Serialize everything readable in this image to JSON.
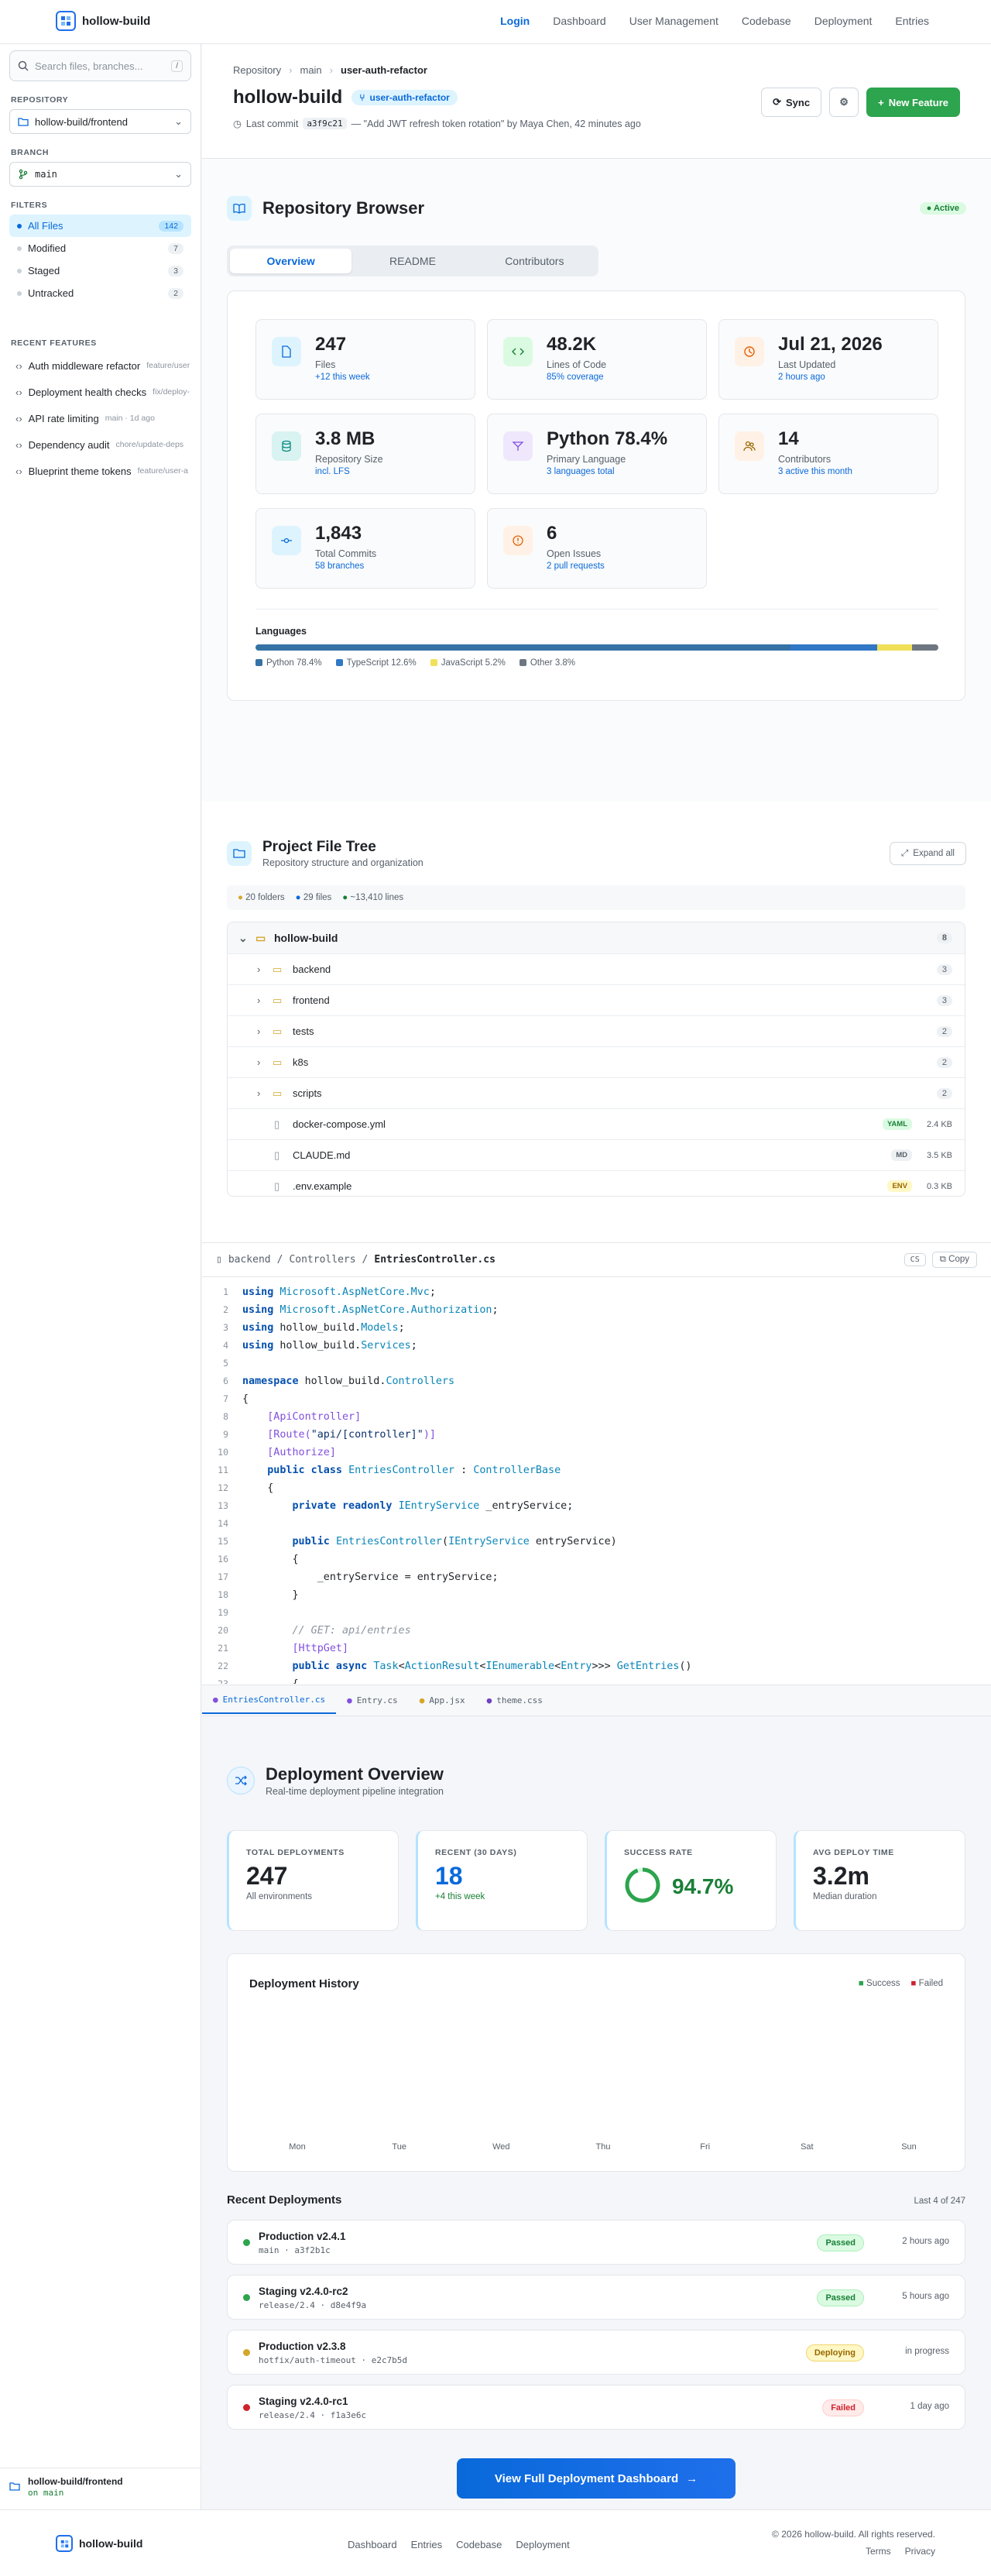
{
  "nav": {
    "brand": "hollow-build",
    "links": [
      "Login",
      "Dashboard",
      "User Management",
      "Codebase",
      "Deployment",
      "Entries"
    ]
  },
  "sidebar": {
    "search_placeholder": "Search files, branches...",
    "search_kbd": "/",
    "repo_label": "REPOSITORY",
    "repo_value": "hollow-build/frontend",
    "branch_label": "BRANCH",
    "branch_value": "main",
    "filters_label": "FILTERS",
    "filters": [
      {
        "label": "All Files",
        "count": "142"
      },
      {
        "label": "Modified",
        "count": "7"
      },
      {
        "label": "Staged",
        "count": "3"
      },
      {
        "label": "Untracked",
        "count": "2"
      }
    ],
    "recent_label": "RECENT FEATURES",
    "recent": [
      {
        "name": "Auth middleware refactor",
        "meta": "feature/user"
      },
      {
        "name": "Deployment health checks",
        "meta": "fix/deploy-"
      },
      {
        "name": "API rate limiting",
        "meta": "main · 1d ago"
      },
      {
        "name": "Dependency audit",
        "meta": "chore/update-deps"
      },
      {
        "name": "Blueprint theme tokens",
        "meta": "feature/user-a"
      }
    ],
    "footer_repo": "hollow-build/frontend",
    "footer_branch": "on main"
  },
  "repo": {
    "crumbs": [
      "Repository",
      "main",
      "user-auth-refactor"
    ],
    "title": "hollow-build",
    "branch_chip": "user-auth-refactor",
    "last_commit_label": "Last commit",
    "commit_hash": "a3f9c21",
    "commit_msg": "— \"Add JWT refresh token rotation\" by Maya Chen, 42 minutes ago",
    "sync": "Sync",
    "new_feature": "New Feature"
  },
  "browser": {
    "title": "Repository Browser",
    "status": "Active",
    "tabs": [
      "Overview",
      "README",
      "Contributors"
    ],
    "stats": [
      {
        "value": "247",
        "label": "Files",
        "sub": "+12 this week"
      },
      {
        "value": "48.2K",
        "label": "Lines of Code",
        "sub": "85% coverage"
      },
      {
        "value": "Jul 21, 2026",
        "label": "Last Updated",
        "sub": "2 hours ago"
      },
      {
        "value": "3.8 MB",
        "label": "Repository Size",
        "sub": "incl. LFS"
      },
      {
        "value": "Python 78.4%",
        "label": "Primary Language",
        "sub": "3 languages total"
      },
      {
        "value": "14",
        "label": "Contributors",
        "sub": "3 active this month"
      },
      {
        "value": "1,843",
        "label": "Total Commits",
        "sub": "58 branches"
      },
      {
        "value": "6",
        "label": "Open Issues",
        "sub": "2 pull requests"
      }
    ],
    "languages_label": "Languages",
    "languages": [
      {
        "name": "Python 78.4%",
        "pct": 78.4,
        "color": "#3572A5"
      },
      {
        "name": "TypeScript 12.6%",
        "pct": 12.6,
        "color": "#3178c6"
      },
      {
        "name": "JavaScript 5.2%",
        "pct": 5.2,
        "color": "#f1e05a"
      },
      {
        "name": "Other 3.8%",
        "pct": 3.8,
        "color": "#6e7781"
      }
    ]
  },
  "tree": {
    "title": "Project File Tree",
    "subtitle": "Repository structure and organization",
    "expand": "Expand all",
    "summary": [
      "20 folders",
      "29 files",
      "~13,410 lines"
    ],
    "root": {
      "name": "hollow-build",
      "count": "8"
    },
    "folders": [
      {
        "name": "backend",
        "count": "3"
      },
      {
        "name": "frontend",
        "count": "3"
      },
      {
        "name": "tests",
        "count": "2"
      },
      {
        "name": "k8s",
        "count": "2"
      },
      {
        "name": "scripts",
        "count": "2"
      }
    ],
    "files": [
      {
        "name": "docker-compose.yml",
        "tag": "YAML",
        "size": "2.4 KB"
      },
      {
        "name": "CLAUDE.md",
        "tag": "MD",
        "size": "3.5 KB"
      },
      {
        "name": ".env.example",
        "tag": "ENV",
        "size": "0.3 KB"
      }
    ]
  },
  "code": {
    "path": [
      "backend",
      "Controllers",
      "EntriesController.cs"
    ],
    "lang": "CS",
    "copy": "Copy",
    "tabs": [
      "EntriesController.cs",
      "Entry.cs",
      "App.jsx",
      "theme.css"
    ]
  },
  "deploy": {
    "title": "Deployment Overview",
    "subtitle": "Real-time deployment pipeline integration",
    "stats": [
      {
        "label": "TOTAL DEPLOYMENTS",
        "value": "247",
        "sub": "All environments"
      },
      {
        "label": "RECENT (30 DAYS)",
        "value": "18",
        "sub": "+4 this week"
      },
      {
        "label": "SUCCESS RATE",
        "value": "94.7%",
        "sub": ""
      },
      {
        "label": "AVG DEPLOY TIME",
        "value": "3.2m",
        "sub": "Median duration"
      }
    ],
    "success_rate": 0.947,
    "history_title": "Deployment History",
    "legend": [
      "Success",
      "Failed"
    ],
    "recent_title": "Recent Deployments",
    "recent_count": "Last 4 of 247",
    "items": [
      {
        "name": "Production v2.4.1",
        "branch": "main · a3f2b1c",
        "status": "Passed",
        "time": "2 hours ago",
        "color": "#2da44e"
      },
      {
        "name": "Staging v2.4.0-rc2",
        "branch": "release/2.4 · d8e4f9a",
        "status": "Passed",
        "time": "5 hours ago",
        "color": "#2da44e"
      },
      {
        "name": "Production v2.3.8",
        "branch": "hotfix/auth-timeout · e2c7b5d",
        "status": "Deploying",
        "time": "in progress",
        "color": "#d4a72c"
      },
      {
        "name": "Staging v2.4.0-rc1",
        "branch": "release/2.4 · f1a3e6c",
        "status": "Failed",
        "time": "1 day ago",
        "color": "#cf222e"
      }
    ],
    "cta": "View Full Deployment Dashboard"
  },
  "chart_data": {
    "type": "bar",
    "title": "Deployment History",
    "categories": [
      "Mon",
      "Tue",
      "Wed",
      "Thu",
      "Fri",
      "Sat",
      "Sun"
    ],
    "series": [
      {
        "name": "Success",
        "values": []
      },
      {
        "name": "Failed",
        "values": []
      }
    ],
    "legend": "top-right"
  },
  "footer": {
    "brand": "hollow-build",
    "links": [
      "Dashboard",
      "Entries",
      "Codebase",
      "Deployment"
    ],
    "copyright": "© 2026 hollow-build. All rights reserved.",
    "legal": [
      "Terms",
      "Privacy"
    ]
  }
}
